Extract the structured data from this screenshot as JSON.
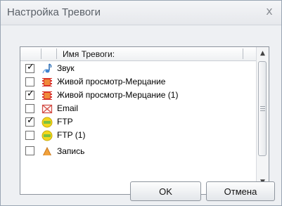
{
  "dialog": {
    "title": "Настройка Тревоги",
    "close_glyph": "x"
  },
  "list": {
    "column_header": "Имя Тревоги:",
    "rows": [
      {
        "checked": true,
        "icon": "sound-icon",
        "label": "Звук"
      },
      {
        "checked": false,
        "icon": "film-icon",
        "label": "Живой просмотр-Мерцание"
      },
      {
        "checked": true,
        "icon": "film-icon",
        "label": "Живой просмотр-Мерцание (1)"
      },
      {
        "checked": false,
        "icon": "email-icon",
        "label": "Email"
      },
      {
        "checked": true,
        "icon": "ftp-icon",
        "label": "FTP"
      },
      {
        "checked": false,
        "icon": "ftp-icon",
        "label": "FTP (1)"
      },
      {
        "checked": false,
        "icon": "record-icon",
        "label": "Запись"
      }
    ]
  },
  "buttons": {
    "ok": "OK",
    "cancel": "Отмена"
  },
  "colors": {
    "accent_green": "#7ac143",
    "ftp_yellow": "#f3d71c"
  }
}
